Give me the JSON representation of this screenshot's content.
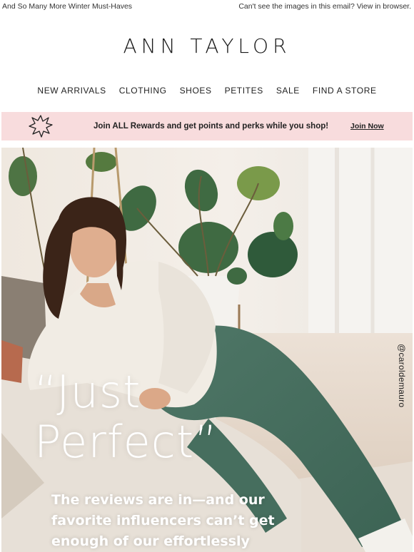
{
  "preheader": {
    "left_text": "And So Many More Winter Must-Haves",
    "right_text": "Can't see the images in this email? View in browser."
  },
  "brand": {
    "logo_text": "ANN TAYLOR"
  },
  "nav": {
    "items": [
      {
        "label": "NEW ARRIVALS"
      },
      {
        "label": "CLOTHING"
      },
      {
        "label": "SHOES"
      },
      {
        "label": "PETITES"
      },
      {
        "label": "SALE"
      },
      {
        "label": "FIND A STORE"
      }
    ]
  },
  "rewards_banner": {
    "icon": "starburst-icon",
    "message": "Join ALL Rewards and get points and perks while you shop!",
    "cta_label": "Join Now",
    "bg_color": "#f8dcdd"
  },
  "hero": {
    "credit": "@caroldemauro",
    "headline_line1": "“Just",
    "headline_line2": "Perfect”",
    "subcopy": "The reviews are in—and our favorite influencers can’t get enough of our effortlessly"
  }
}
